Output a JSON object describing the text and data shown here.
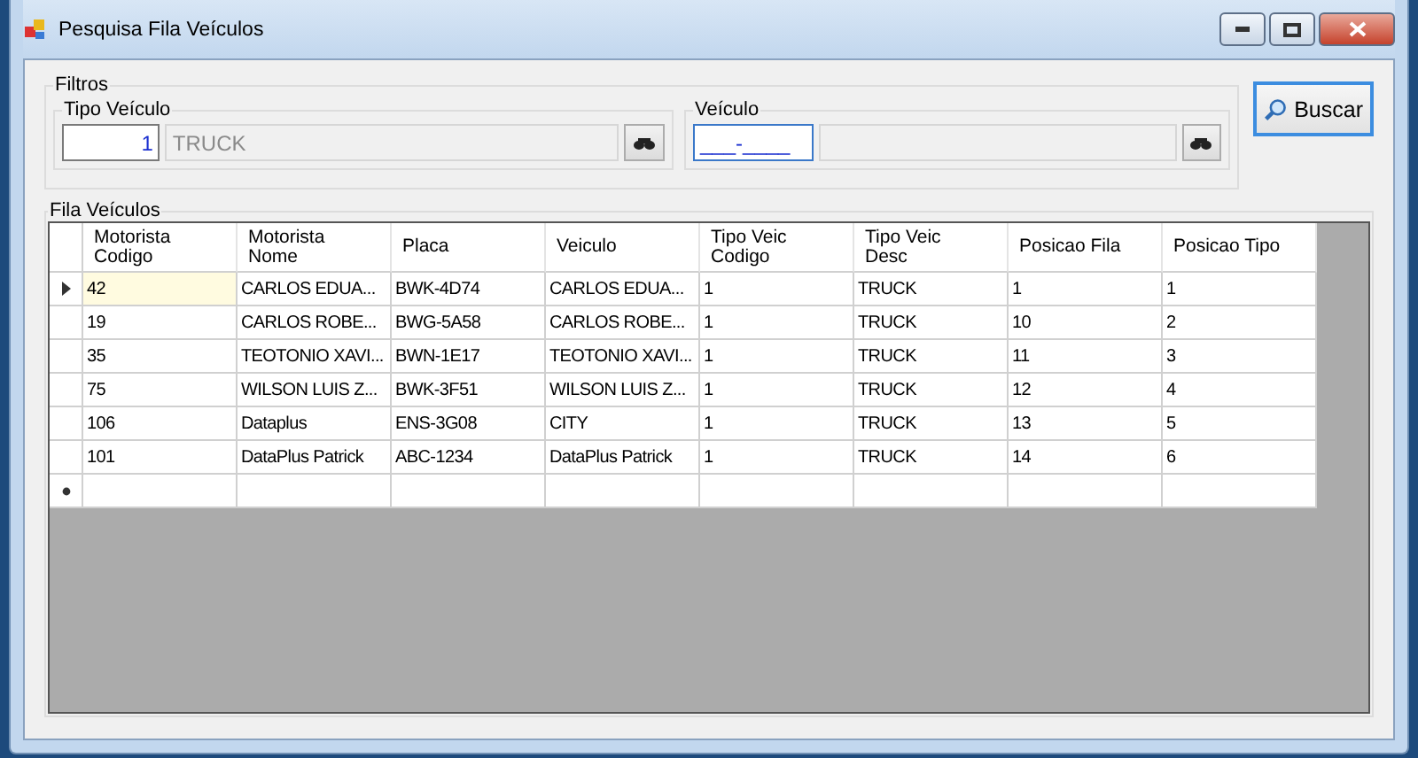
{
  "window": {
    "title": "Pesquisa Fila Veículos"
  },
  "filters": {
    "title": "Filtros",
    "tipo_veiculo": {
      "label": "Tipo Veículo",
      "code": "1",
      "description": "TRUCK"
    },
    "veiculo": {
      "label": "Veículo",
      "plate": "___-____",
      "focused": true
    }
  },
  "search_button": {
    "label": "Buscar"
  },
  "queue": {
    "title": "Fila Veículos",
    "columns": [
      "Motorista\nCodigo",
      "Motorista\nNome",
      "Placa",
      "Veiculo",
      "Tipo Veic\nCodigo",
      "Tipo Veic\nDesc",
      "Posicao Fila",
      "Posicao Tipo"
    ],
    "rows": [
      {
        "selected": true,
        "cells": [
          "42",
          "CARLOS EDUA...",
          "BWK-4D74",
          "CARLOS EDUA...",
          "1",
          "TRUCK",
          "1",
          "1"
        ]
      },
      {
        "selected": false,
        "cells": [
          "19",
          "CARLOS ROBE...",
          "BWG-5A58",
          "CARLOS ROBE...",
          "1",
          "TRUCK",
          "10",
          "2"
        ]
      },
      {
        "selected": false,
        "cells": [
          "35",
          "TEOTONIO XAVI...",
          "BWN-1E17",
          "TEOTONIO XAVI...",
          "1",
          "TRUCK",
          "11",
          "3"
        ]
      },
      {
        "selected": false,
        "cells": [
          "75",
          "WILSON LUIS Z...",
          "BWK-3F51",
          "WILSON LUIS Z...",
          "1",
          "TRUCK",
          "12",
          "4"
        ]
      },
      {
        "selected": false,
        "cells": [
          "106",
          "Dataplus",
          "ENS-3G08",
          "CITY",
          "1",
          "TRUCK",
          "13",
          "5"
        ]
      },
      {
        "selected": false,
        "cells": [
          "101",
          "DataPlus Patrick",
          "ABC-1234",
          "DataPlus Patrick",
          "1",
          "TRUCK",
          "14",
          "6"
        ]
      }
    ],
    "new_row": true
  }
}
